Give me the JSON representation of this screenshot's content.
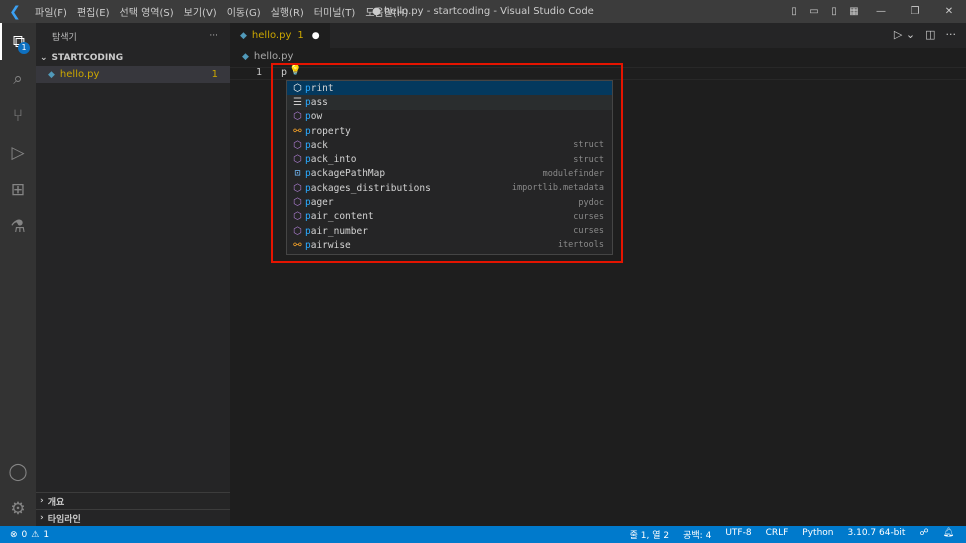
{
  "titlebar": {
    "menus": [
      "파일(F)",
      "편집(E)",
      "선택 영역(S)",
      "보기(V)",
      "이동(G)",
      "실행(R)",
      "터미널(T)",
      "도움말(H)"
    ],
    "title": "● hello.py - startcoding - Visual Studio Code"
  },
  "activity": {
    "explorer_badge": "1"
  },
  "sidebar": {
    "title": "탐색기",
    "more": "···",
    "folder": "STARTCODING",
    "file": "hello.py",
    "file_problems": "1",
    "outline": "개요",
    "timeline": "타임라인"
  },
  "editor": {
    "tab": {
      "label": "hello.py",
      "problems": "1",
      "dirty": "●"
    },
    "breadcrumb": "hello.py",
    "line_number": "1",
    "code": "p"
  },
  "suggest": [
    {
      "label": "print",
      "match": "p",
      "icon": "method",
      "detail": ""
    },
    {
      "label": "pass",
      "match": "p",
      "icon": "keyword",
      "detail": ""
    },
    {
      "label": "pow",
      "match": "p",
      "icon": "method",
      "detail": ""
    },
    {
      "label": "property",
      "match": "p",
      "icon": "class",
      "detail": ""
    },
    {
      "label": "pack",
      "match": "p",
      "icon": "method",
      "detail": "struct"
    },
    {
      "label": "pack_into",
      "match": "p",
      "icon": "method",
      "detail": "struct"
    },
    {
      "label": "packagePathMap",
      "match": "p",
      "icon": "variable",
      "detail": "modulefinder"
    },
    {
      "label": "packages_distributions",
      "match": "p",
      "icon": "method",
      "detail": "importlib.metadata"
    },
    {
      "label": "pager",
      "match": "p",
      "icon": "method",
      "detail": "pydoc"
    },
    {
      "label": "pair_content",
      "match": "p",
      "icon": "method",
      "detail": "curses"
    },
    {
      "label": "pair_number",
      "match": "p",
      "icon": "method",
      "detail": "curses"
    },
    {
      "label": "pairwise",
      "match": "p",
      "icon": "class",
      "detail": "itertools"
    }
  ],
  "statusbar": {
    "errors": "0",
    "warnings": "1",
    "position": "줄 1, 열 2",
    "spaces": "공백: 4",
    "encoding": "UTF-8",
    "eol": "CRLF",
    "language": "Python",
    "interpreter": "3.10.7 64-bit"
  }
}
